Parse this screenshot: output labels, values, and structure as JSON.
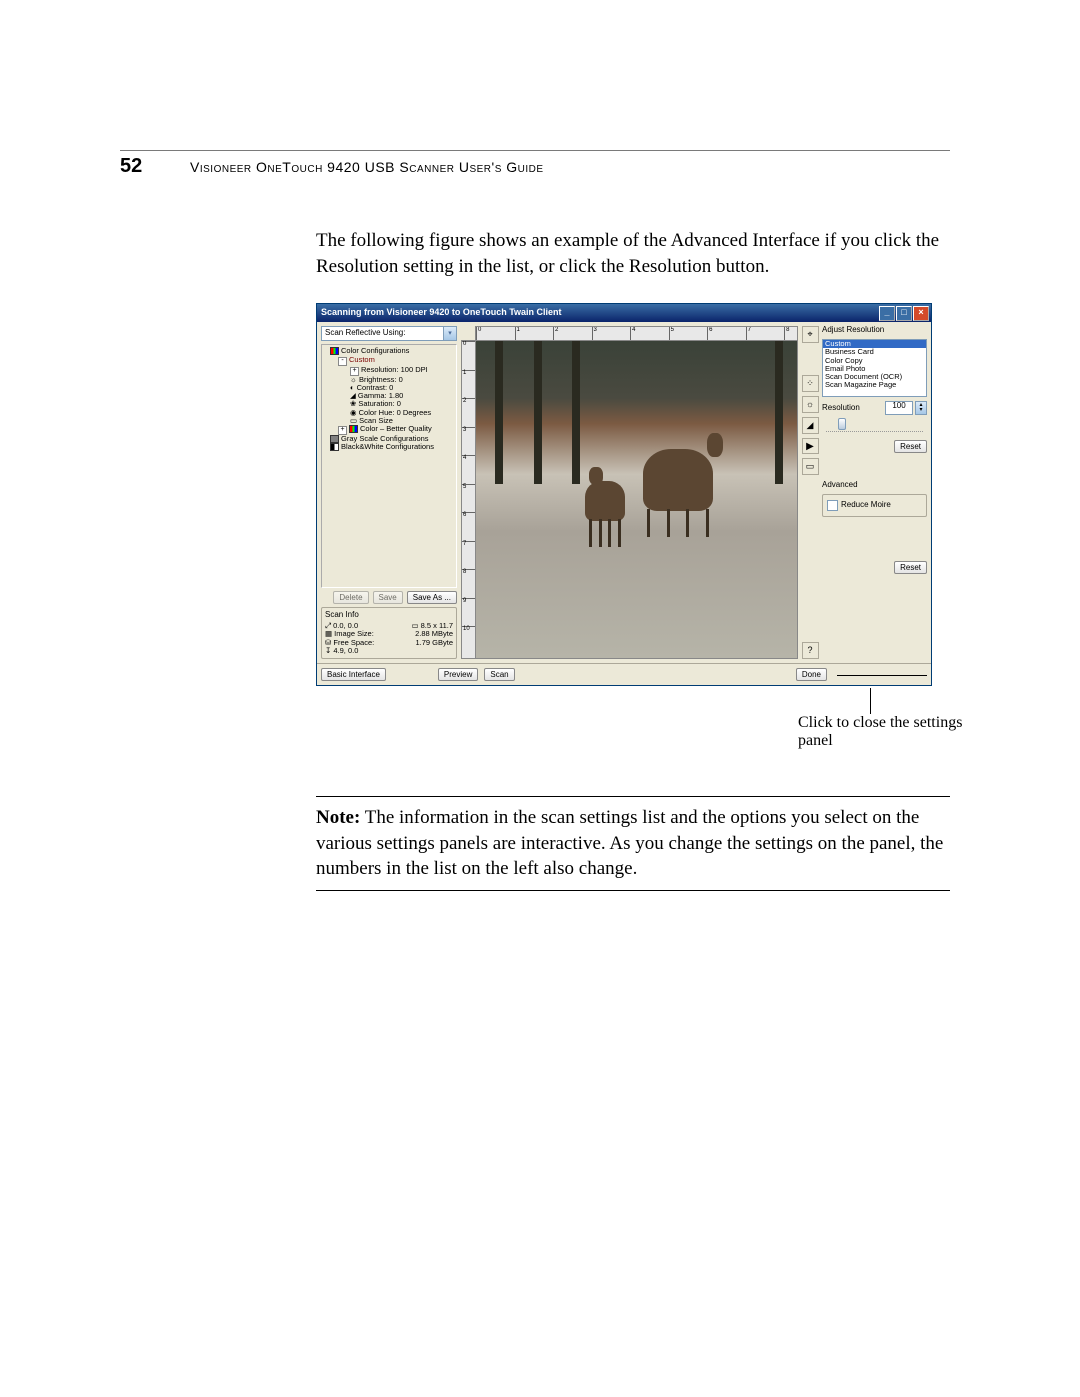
{
  "page_number": "52",
  "header_title": "Visioneer OneTouch 9420 USB Scanner User's Guide",
  "intro_para": "The following figure shows an example of the Advanced Interface if you click the Resolution setting in the list, or click the Resolution button.",
  "note_label": "Note:",
  "note_body": " The information in the scan settings list and the options you select on the various settings panels are interactive. As you change the settings on the panel, the numbers in the list on the left also change.",
  "callout": "Click to close the settings panel",
  "win": {
    "title": "Scanning from Visioneer 9420 to OneTouch Twain Client",
    "dropdown_label": "Scan Reflective Using:",
    "tree": {
      "color_conf": "Color Configurations",
      "custom": "Custom",
      "resolution": "Resolution: 100 DPI",
      "brightness": "Brightness: 0",
      "contrast": "Contrast: 0",
      "gamma": "Gamma: 1.80",
      "saturation": "Saturation: 0",
      "colorhue": "Color Hue: 0 Degrees",
      "scansize": "Scan Size",
      "better_quality": "Color – Better Quality",
      "gray_conf": "Gray Scale Configurations",
      "bw_conf": "Black&White Configurations"
    },
    "left_btns": {
      "delete": "Delete",
      "save": "Save",
      "saveas": "Save As ..."
    },
    "scaninfo": {
      "title": "Scan Info",
      "wh": "0.0, 0.0",
      "size": "8.5 x 11.7",
      "imgsize_label": "Image Size:",
      "imgsize_val": "2.88 MByte",
      "free_label": "Free Space:",
      "free_val": "1.79 GByte",
      "coord": "4.9, 0.0"
    },
    "tools": {
      "ruler": "⌖",
      "resolution": "⁘",
      "brightness": "☼",
      "gamma": "◢",
      "arrow": "▶",
      "crop": "▭",
      "help": "?"
    },
    "right": {
      "title": "Adjust Resolution",
      "options": [
        "Custom",
        "Business Card",
        "Color Copy",
        "Email Photo",
        "Scan Document (OCR)",
        "Scan Magazine Page"
      ],
      "res_label": "Resolution",
      "res_value": "100",
      "reset": "Reset",
      "advanced": "Advanced",
      "moire": "Reduce Moire",
      "reset2": "Reset"
    },
    "bottom": {
      "basic": "Basic Interface",
      "preview": "Preview",
      "scan": "Scan",
      "done": "Done"
    }
  }
}
